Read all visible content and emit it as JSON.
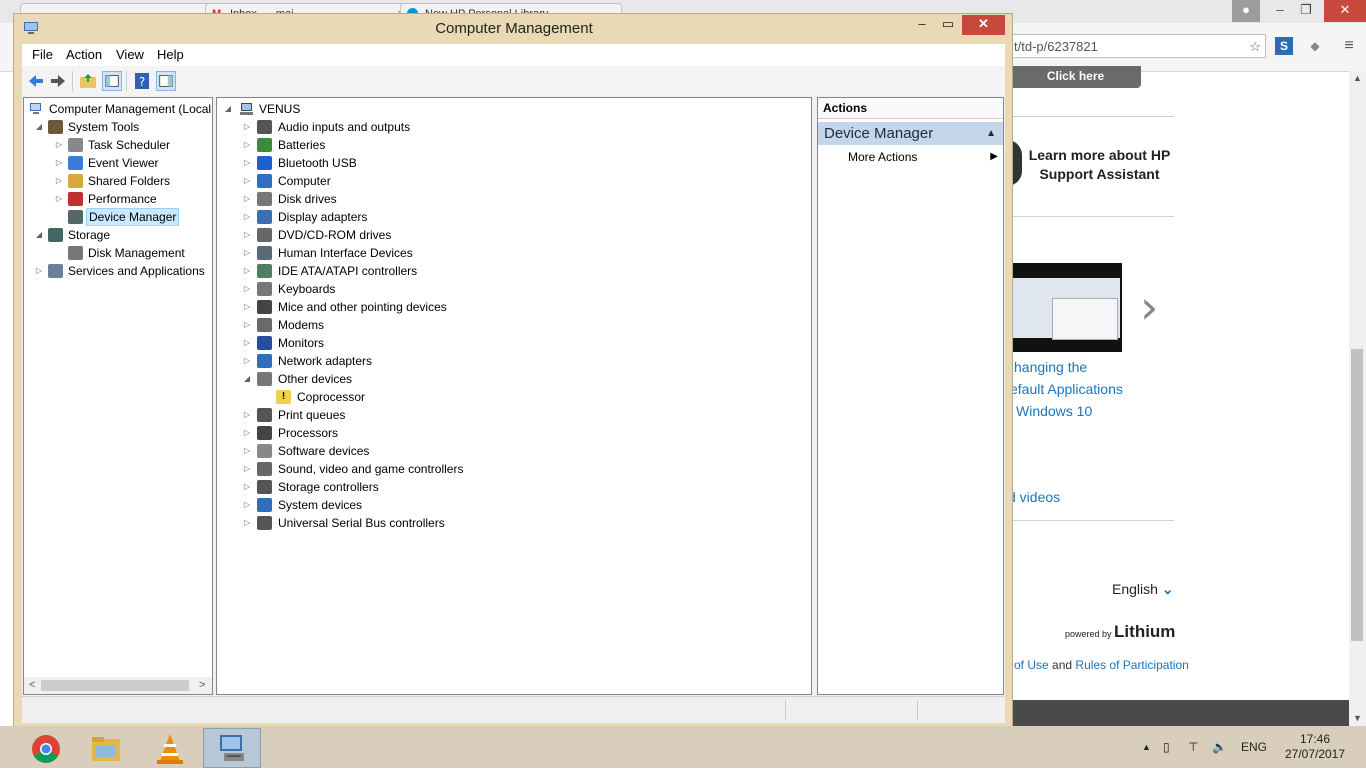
{
  "browser": {
    "tabs": [
      {
        "title": "",
        "close": "×"
      },
      {
        "title": "Inbox - ...mai...",
        "close": "×"
      },
      {
        "title": "New HP Personal Library",
        "close": ""
      }
    ],
    "url_fragment": "t/td-p/6237821",
    "click_here": "Click here",
    "hp_promo": "Learn more about HP Support Assistant",
    "article_lines": [
      "hanging the",
      "efault Applications",
      "Windows 10"
    ],
    "videos_link": "d videos",
    "language": "English",
    "powered_by": "powered by",
    "powered_brand": "Lithium",
    "terms_prefix": "of Use",
    "terms_and": "and",
    "terms_link": "Rules of Participation"
  },
  "window": {
    "title": "Computer Management",
    "buttons": {
      "minimize": "–",
      "maximize": "▭",
      "close": "✕"
    }
  },
  "menu": [
    "File",
    "Action",
    "View",
    "Help"
  ],
  "left_tree": {
    "root": "Computer Management (Local",
    "items": [
      {
        "label": "System Tools",
        "level": 1,
        "expander": "◢"
      },
      {
        "label": "Task Scheduler",
        "level": 2,
        "expander": "▷"
      },
      {
        "label": "Event Viewer",
        "level": 2,
        "expander": "▷"
      },
      {
        "label": "Shared Folders",
        "level": 2,
        "expander": "▷"
      },
      {
        "label": "Performance",
        "level": 2,
        "expander": "▷"
      },
      {
        "label": "Device Manager",
        "level": 2,
        "expander": "",
        "selected": true
      },
      {
        "label": "Storage",
        "level": 1,
        "expander": "◢"
      },
      {
        "label": "Disk Management",
        "level": 2,
        "expander": ""
      },
      {
        "label": "Services and Applications",
        "level": 1,
        "expander": "▷"
      }
    ]
  },
  "device_tree": {
    "root": "VENUS",
    "items": [
      {
        "label": "Audio inputs and outputs",
        "expander": "▷"
      },
      {
        "label": "Batteries",
        "expander": "▷"
      },
      {
        "label": "Bluetooth USB",
        "expander": "▷"
      },
      {
        "label": "Computer",
        "expander": "▷"
      },
      {
        "label": "Disk drives",
        "expander": "▷"
      },
      {
        "label": "Display adapters",
        "expander": "▷"
      },
      {
        "label": "DVD/CD-ROM drives",
        "expander": "▷"
      },
      {
        "label": "Human Interface Devices",
        "expander": "▷"
      },
      {
        "label": "IDE ATA/ATAPI controllers",
        "expander": "▷"
      },
      {
        "label": "Keyboards",
        "expander": "▷"
      },
      {
        "label": "Mice and other pointing devices",
        "expander": "▷"
      },
      {
        "label": "Modems",
        "expander": "▷"
      },
      {
        "label": "Monitors",
        "expander": "▷"
      },
      {
        "label": "Network adapters",
        "expander": "▷"
      },
      {
        "label": "Other devices",
        "expander": "◢"
      },
      {
        "label": "Coprocessor",
        "expander": "",
        "child": true
      },
      {
        "label": "Print queues",
        "expander": "▷"
      },
      {
        "label": "Processors",
        "expander": "▷"
      },
      {
        "label": "Software devices",
        "expander": "▷"
      },
      {
        "label": "Sound, video and game controllers",
        "expander": "▷"
      },
      {
        "label": "Storage controllers",
        "expander": "▷"
      },
      {
        "label": "System devices",
        "expander": "▷"
      },
      {
        "label": "Universal Serial Bus controllers",
        "expander": "▷"
      }
    ]
  },
  "actions": {
    "header": "Actions",
    "section": "Device Manager",
    "item": "More Actions"
  },
  "taskbar": {
    "apps": [
      "chrome-icon",
      "file-explorer-icon",
      "vlc-icon",
      "computer-management-icon"
    ],
    "language": "ENG",
    "time": "17:46",
    "date": "27/07/2017"
  },
  "colors": {
    "selection": "#cce8ff",
    "window_frame": "#e9d9b4",
    "close_button": "#c7493b",
    "link": "#1a75bb"
  }
}
